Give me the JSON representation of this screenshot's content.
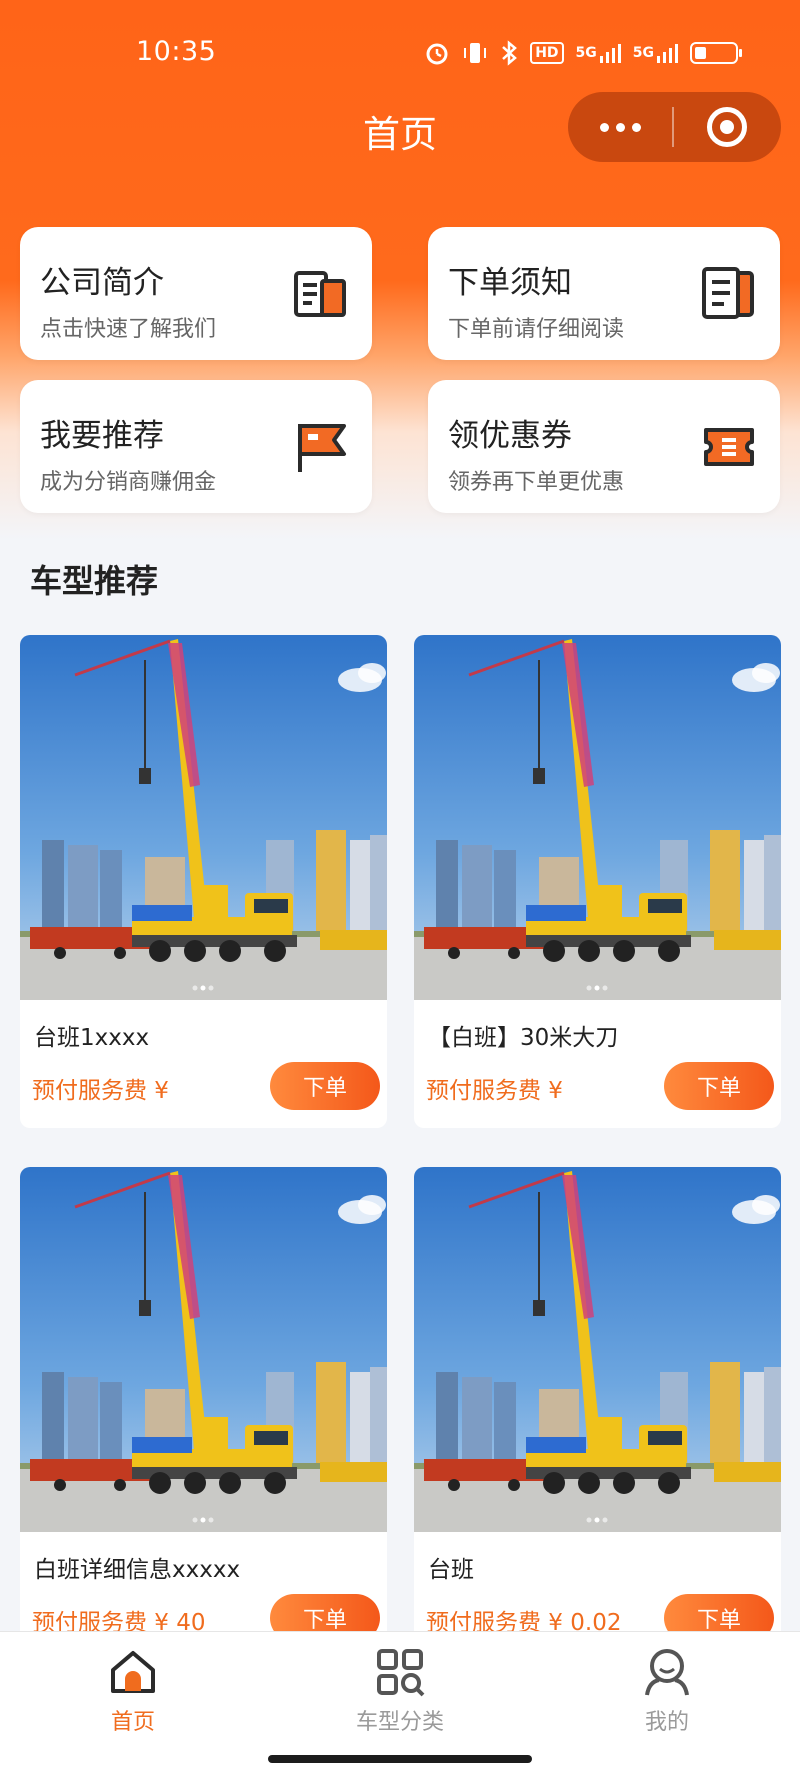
{
  "status_bar": {
    "time": "10:35",
    "icons": [
      "alarm-icon",
      "vibrate-icon",
      "bluetooth-icon",
      "hd-icon",
      "5g-signal-icon",
      "5g-signal-icon",
      "battery-icon"
    ],
    "hd_label": "HD",
    "network_label_1": "5G",
    "network_label_2": "5G",
    "battery_level": 0.3
  },
  "nav": {
    "title": "首页"
  },
  "shortcuts": [
    {
      "title": "公司简介",
      "subtitle": "点击快速了解我们",
      "icon": "document-icon"
    },
    {
      "title": "下单须知",
      "subtitle": "下单前请仔细阅读",
      "icon": "notice-document-icon"
    },
    {
      "title": "我要推荐",
      "subtitle": "成为分销商赚佣金",
      "icon": "flag-icon"
    },
    {
      "title": "领优惠券",
      "subtitle": "领券再下单更优惠",
      "icon": "coupon-icon"
    }
  ],
  "section": {
    "title": "车型推荐"
  },
  "products": [
    {
      "name": "台班1xxxx",
      "price": "预付服务费 ¥",
      "button": "下单"
    },
    {
      "name": "【白班】30米大刀",
      "price": "预付服务费 ¥",
      "button": "下单"
    },
    {
      "name": "白班详细信息xxxxx",
      "price": "预付服务费 ¥ 40",
      "button": "下单"
    },
    {
      "name": "台班",
      "price": "预付服务费 ¥ 0.02",
      "button": "下单"
    }
  ],
  "tabbar": {
    "items": [
      {
        "label": "首页",
        "icon": "home-icon",
        "active": true
      },
      {
        "label": "车型分类",
        "icon": "category-icon",
        "active": false
      },
      {
        "label": "我的",
        "icon": "profile-icon",
        "active": false
      }
    ]
  },
  "colors": {
    "brand": "#ff6418",
    "accent": "#f06c1e",
    "tab_inactive": "#9a9a9a"
  }
}
